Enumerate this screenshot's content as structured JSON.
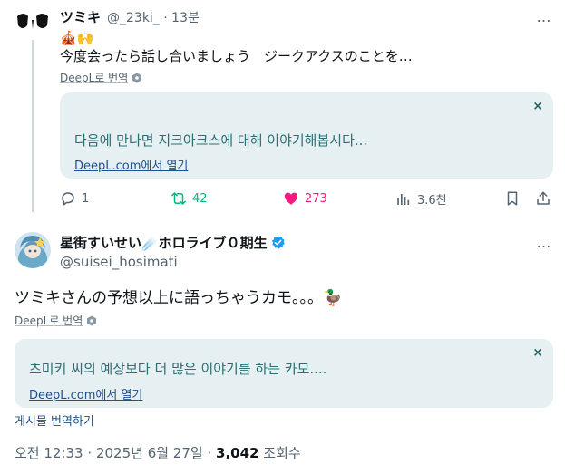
{
  "reply_tweet": {
    "display_name": "ツミキ",
    "handle": "@_23ki_",
    "separator": "·",
    "time_ago": "13분",
    "emoji_line": "🎪🙌",
    "body": "今度会ったら話し合いましょう　ジークアクスのことを…",
    "deepl_label": "DeepL로 번역",
    "translation": {
      "text": "다음에 만나면 지크아크스에 대해 이야기해봅시다...",
      "link": "DeepL.com에서 열기",
      "close": "×"
    },
    "actions": {
      "replies": "1",
      "retweets": "42",
      "likes": "273",
      "views": "3.6천"
    },
    "colors": {
      "retweet": "#00ba7c",
      "like": "#f91880"
    }
  },
  "main_tweet": {
    "display_name": "星街すいせい☄️ホロライブ０期生",
    "verified_icon": "verified-badge-icon",
    "handle": "@suisei_hosimati",
    "body": "ツミキさんの予想以上に語っちゃうカモ。。。🦆",
    "deepl_label": "DeepL로 번역",
    "translation": {
      "text": "츠미키 씨의 예상보다 더 많은 이야기를 하는 카모....",
      "link": "DeepL.com에서 열기",
      "close": "×"
    },
    "translate_post": "게시물 번역하기",
    "footer": {
      "time": "오전 12:33",
      "dot1": "·",
      "date": "2025년 6월 27일",
      "dot2": "·",
      "views_count": "3,042",
      "views_label": "조회수"
    }
  },
  "more_icon": "…"
}
